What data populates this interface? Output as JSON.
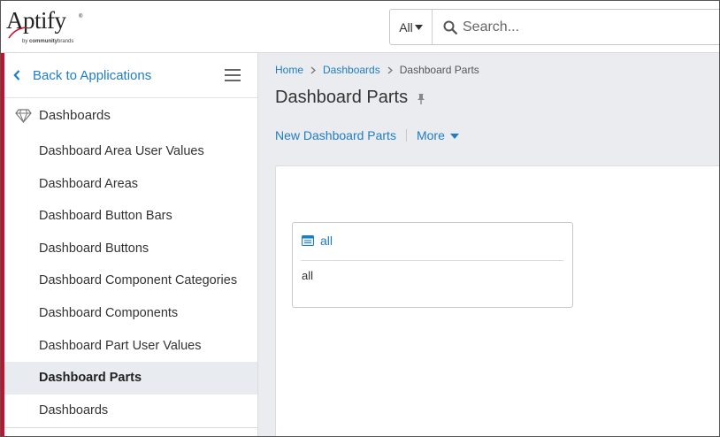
{
  "header": {
    "logo": {
      "word": "Aptify",
      "trademark": "®",
      "sub_prefix": "by",
      "sub_brand": "community",
      "sub_brand_suffix": "brands"
    },
    "search": {
      "scope_label": "All",
      "scope_icon": "caret-down-icon",
      "icon": "search-icon",
      "placeholder": "Search..."
    }
  },
  "sidebar": {
    "back_label": "Back to Applications",
    "back_icon": "chevron-left-icon",
    "menu_icon": "hamburger-icon",
    "section": {
      "icon": "diamond-icon",
      "label": "Dashboards"
    },
    "items": [
      {
        "label": "Dashboard Area User Values",
        "active": false
      },
      {
        "label": "Dashboard Areas",
        "active": false
      },
      {
        "label": "Dashboard Button Bars",
        "active": false
      },
      {
        "label": "Dashboard Buttons",
        "active": false
      },
      {
        "label": "Dashboard Component Categories",
        "active": false
      },
      {
        "label": "Dashboard Components",
        "active": false
      },
      {
        "label": "Dashboard Part User Values",
        "active": false
      },
      {
        "label": "Dashboard Parts",
        "active": true
      },
      {
        "label": "Dashboards",
        "active": false
      }
    ]
  },
  "main": {
    "breadcrumb": {
      "home": "Home",
      "parent": "Dashboards",
      "current": "Dashboard Parts"
    },
    "title": "Dashboard Parts",
    "title_icon": "pin-icon",
    "actions": {
      "new_label": "New Dashboard Parts",
      "more_label": "More",
      "more_icon": "caret-down-icon"
    },
    "card": {
      "icon": "list-icon",
      "title": "all",
      "body": "all"
    }
  },
  "colors": {
    "accent_link": "#1f7dc2",
    "sidebar_accent": "#c8102e",
    "active_item_bg": "#e8ebef",
    "main_bg": "#eaecef"
  }
}
